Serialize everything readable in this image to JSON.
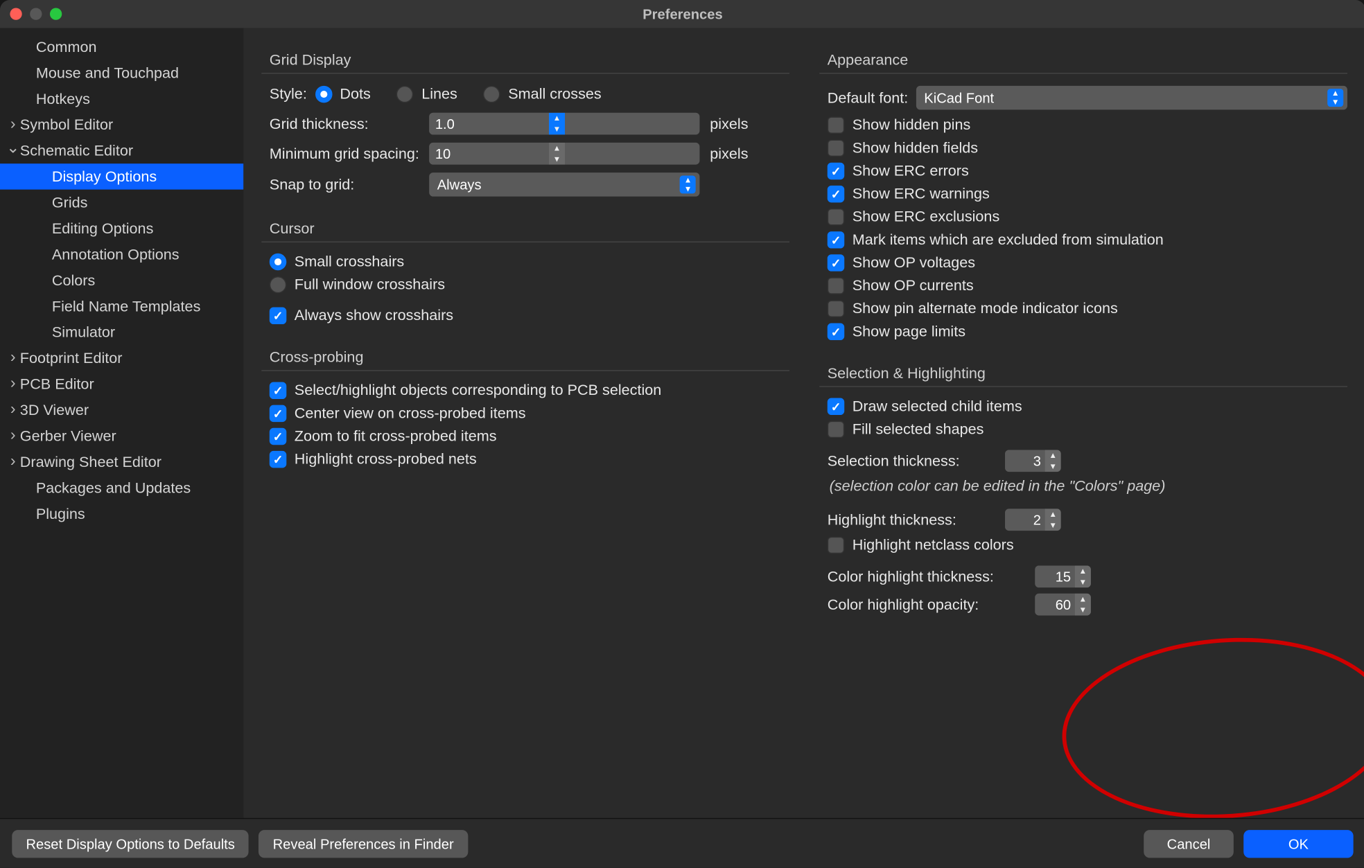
{
  "window": {
    "title": "Preferences"
  },
  "sidebar": {
    "common": "Common",
    "mouse": "Mouse and Touchpad",
    "hotkeys": "Hotkeys",
    "symbol": "Symbol Editor",
    "schematic": "Schematic Editor",
    "display_options": "Display Options",
    "grids": "Grids",
    "editing": "Editing Options",
    "annotation": "Annotation Options",
    "colors": "Colors",
    "field_templates": "Field Name Templates",
    "simulator": "Simulator",
    "footprint": "Footprint Editor",
    "pcb": "PCB Editor",
    "viewer3d": "3D Viewer",
    "gerber": "Gerber Viewer",
    "drawingsheet": "Drawing Sheet Editor",
    "packages": "Packages and Updates",
    "plugins": "Plugins"
  },
  "grid": {
    "section": "Grid Display",
    "style_label": "Style:",
    "dots": "Dots",
    "lines": "Lines",
    "small_crosses": "Small crosses",
    "thickness_label": "Grid thickness:",
    "thickness_value": "1.0",
    "pixels": "pixels",
    "min_spacing_label": "Minimum grid spacing:",
    "min_spacing_value": "10",
    "snap_label": "Snap to grid:",
    "snap_value": "Always"
  },
  "cursor": {
    "section": "Cursor",
    "small": "Small crosshairs",
    "full": "Full window crosshairs",
    "always": "Always show crosshairs"
  },
  "probe": {
    "section": "Cross-probing",
    "select": "Select/highlight objects corresponding to PCB selection",
    "center": "Center view on cross-probed items",
    "zoom": "Zoom to fit cross-probed items",
    "highlight": "Highlight cross-probed nets"
  },
  "appearance": {
    "section": "Appearance",
    "font_label": "Default font:",
    "font_value": "KiCad Font",
    "hidden_pins": "Show hidden pins",
    "hidden_fields": "Show hidden fields",
    "erc_errors": "Show ERC errors",
    "erc_warnings": "Show ERC warnings",
    "erc_exclusions": "Show ERC exclusions",
    "mark_excluded": "Mark items which are excluded from simulation",
    "op_voltages": "Show OP voltages",
    "op_currents": "Show OP currents",
    "pin_alt": "Show pin alternate mode indicator icons",
    "page_limits": "Show page limits"
  },
  "selection": {
    "section": "Selection & Highlighting",
    "draw_child": "Draw selected child items",
    "fill_shapes": "Fill selected shapes",
    "sel_thick_label": "Selection thickness:",
    "sel_thick": "3",
    "note": "(selection color can be edited in the \"Colors\" page)",
    "hi_thick_label": "Highlight thickness:",
    "hi_thick": "2",
    "hi_netclass": "Highlight netclass colors",
    "color_thick_label": "Color highlight thickness:",
    "color_thick": "15",
    "color_opac_label": "Color highlight opacity:",
    "color_opac": "60"
  },
  "footer": {
    "reset": "Reset Display Options to Defaults",
    "reveal": "Reveal Preferences in Finder",
    "cancel": "Cancel",
    "ok": "OK"
  }
}
